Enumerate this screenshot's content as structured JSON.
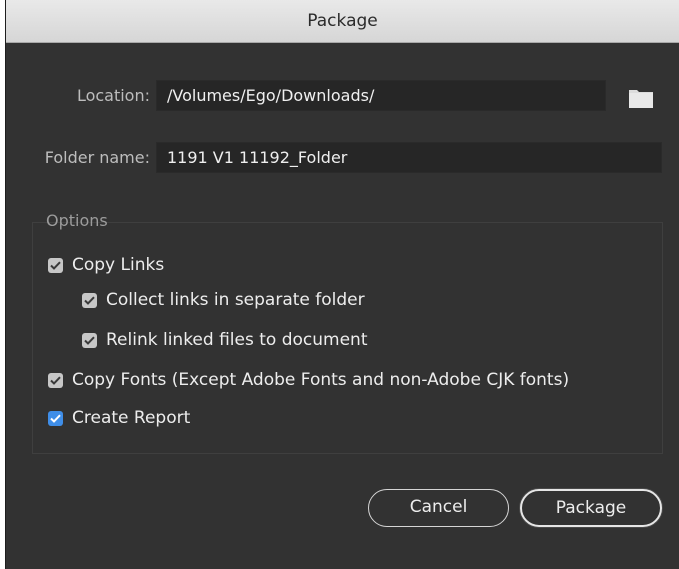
{
  "dialog": {
    "title": "Package"
  },
  "location": {
    "label": "Location:",
    "value": "/Volumes/Ego/Downloads/",
    "browse_icon": "folder-icon"
  },
  "folder_name": {
    "label": "Folder name:",
    "value": "1191 V1 11192_Folder"
  },
  "options": {
    "group_label": "Options",
    "items": [
      {
        "label": "Copy Links",
        "checked": true
      },
      {
        "label": "Collect links in separate folder",
        "checked": true
      },
      {
        "label": "Relink linked files to document",
        "checked": true
      },
      {
        "label": "Copy Fonts (Except Adobe Fonts and non-Adobe CJK fonts)",
        "checked": true
      },
      {
        "label": "Create Report",
        "checked": true
      }
    ]
  },
  "buttons": {
    "cancel": "Cancel",
    "package": "Package"
  },
  "colors": {
    "dialog_bg": "#323232",
    "field_bg": "#262626",
    "checkbox_gray": "#c7c7c7",
    "checkbox_blue": "#3f8ee8"
  }
}
